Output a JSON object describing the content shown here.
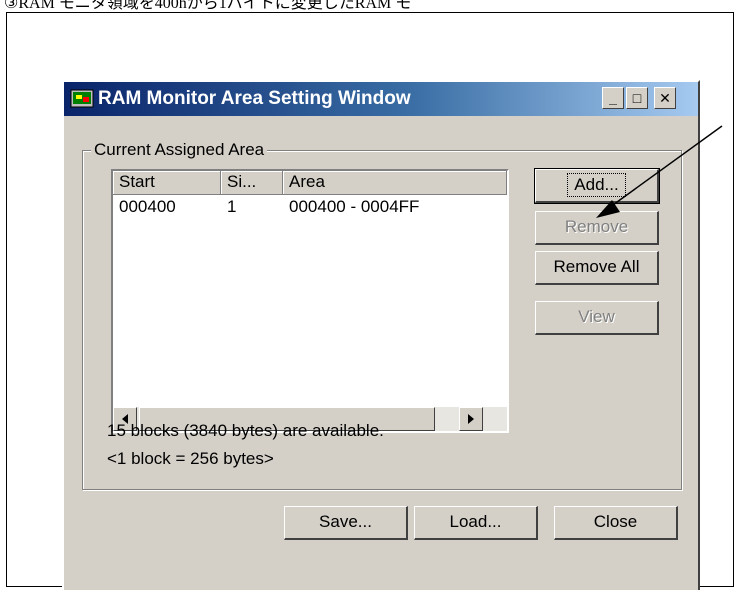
{
  "caption": "③RAM モニタ領域を400hから1バイトに変更したRAM モ",
  "window": {
    "title": "RAM Monitor Area Setting Window",
    "minimize_glyph": "_",
    "maximize_glyph": "□",
    "close_glyph": "✕"
  },
  "group": {
    "label": "Current Assigned Area"
  },
  "list": {
    "columns": [
      "Start",
      "Si...",
      "Area"
    ],
    "rows": [
      {
        "start": "000400",
        "size": "1",
        "area": "000400 - 0004FF"
      }
    ]
  },
  "buttons": {
    "add": "Add...",
    "remove": "Remove",
    "remove_all": "Remove All",
    "view": "View",
    "save": "Save...",
    "load": "Load...",
    "close": "Close"
  },
  "info": {
    "available": "15 blocks (3840 bytes) are available.",
    "block_size": "<1 block = 256 bytes>"
  }
}
